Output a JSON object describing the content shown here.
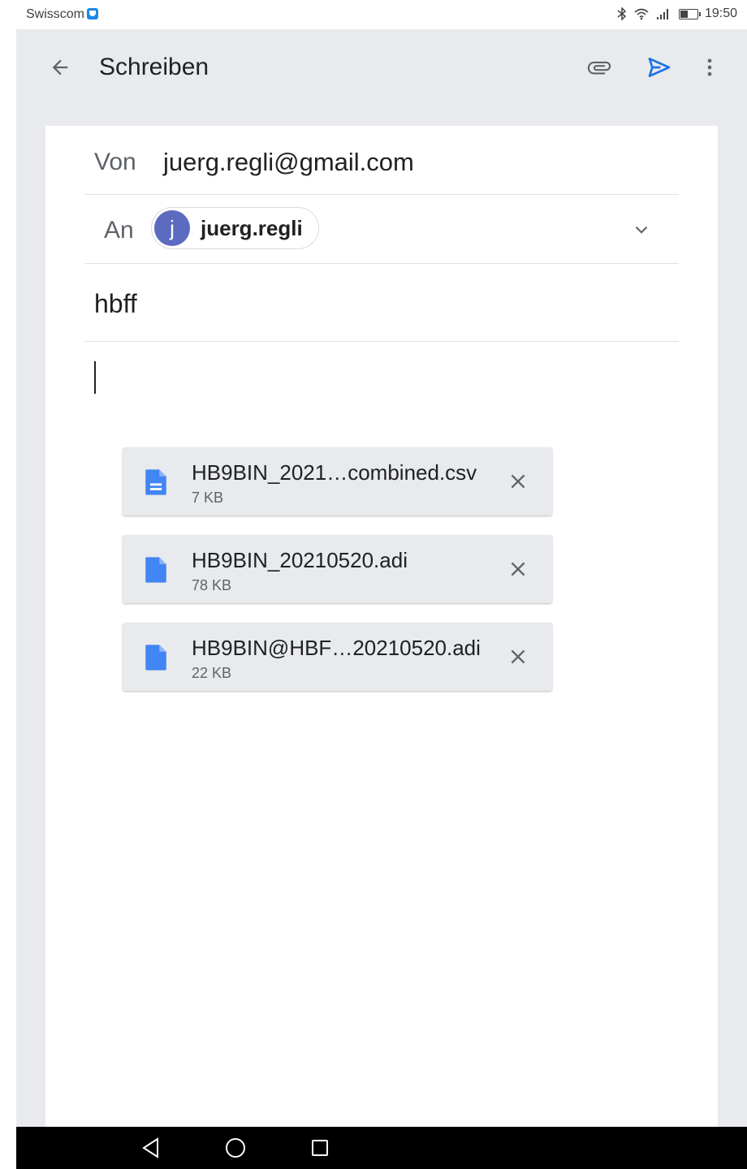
{
  "status_bar": {
    "carrier": "Swisscom",
    "time": "19:50"
  },
  "toolbar": {
    "title": "Schreiben",
    "icons": [
      "back-arrow-icon",
      "paperclip-icon",
      "send-icon",
      "more-vert-icon"
    ]
  },
  "compose": {
    "from_label": "Von",
    "from_value": "juerg.regli@gmail.com",
    "to_label": "An",
    "recipient": {
      "avatar_letter": "j",
      "name": "juerg.regli"
    },
    "subject": "hbff",
    "body": ""
  },
  "attachments": [
    {
      "name": "HB9BIN_2021…combined.csv",
      "size": "7 KB",
      "icon": "document-lines-icon"
    },
    {
      "name": "HB9BIN_20210520.adi",
      "size": "78 KB",
      "icon": "document-icon"
    },
    {
      "name": "HB9BIN@HBF…20210520.adi",
      "size": "22 KB",
      "icon": "document-icon"
    }
  ],
  "colors": {
    "accent": "#1a73e8",
    "avatar": "#5c6bc0",
    "frame": "#e8eaed"
  }
}
